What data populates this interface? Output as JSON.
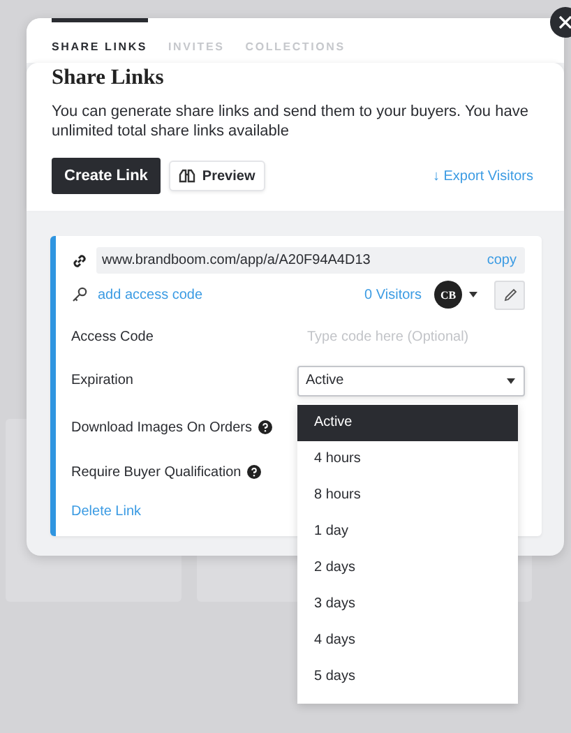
{
  "tabs": [
    {
      "label": "SHARE LINKS",
      "selected": true
    },
    {
      "label": "INVITES",
      "selected": false
    },
    {
      "label": "COLLECTIONS",
      "selected": false
    }
  ],
  "title": "Share Links",
  "description": "You can generate share links and send them to your buyers. You have unlimited total share links available",
  "actions": {
    "create": "Create Link",
    "preview": "Preview",
    "export": "↓ Export Visitors"
  },
  "link": {
    "url": "www.brandboom.com/app/a/A20F94A4D13",
    "copy": "copy",
    "add_access_code": "add access code",
    "visitors": "0 Visitors",
    "avatar": "CB"
  },
  "access_code": {
    "label": "Access Code",
    "placeholder": "Type code here (Optional)"
  },
  "expiration": {
    "label": "Expiration",
    "value": "Active",
    "expanded": true
  },
  "settings": [
    {
      "label": "Download Images On Orders"
    },
    {
      "label": "Require Buyer Qualification"
    }
  ],
  "delete_link": "Delete Link",
  "expiration_options": [
    {
      "label": "Active",
      "selected": true
    },
    {
      "label": "4 hours",
      "selected": false
    },
    {
      "label": "8 hours",
      "selected": false
    },
    {
      "label": "1 day",
      "selected": false
    },
    {
      "label": "2 days",
      "selected": false
    },
    {
      "label": "3 days",
      "selected": false
    },
    {
      "label": "4 days",
      "selected": false
    },
    {
      "label": "5 days",
      "selected": false
    }
  ]
}
